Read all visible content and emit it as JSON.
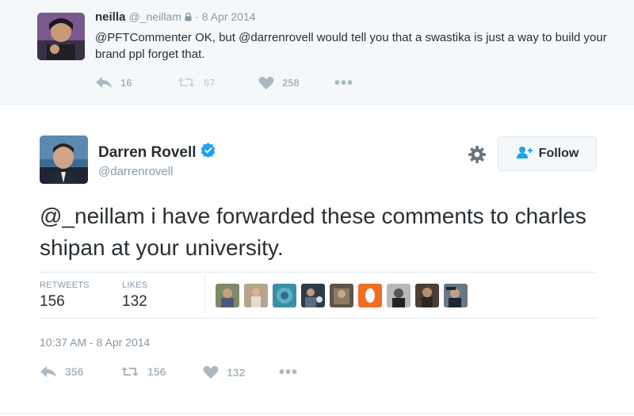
{
  "reply": {
    "name": "neilla",
    "handle": "@_neillam",
    "date_sep": "· 8 Apr 2014",
    "text": "@PFTCommenter OK, but @darrenrovell would tell you that a swastika is just a way to build your brand ppl forget that.",
    "counts": {
      "replies": "16",
      "retweets": "67",
      "likes": "258"
    },
    "more": "•••"
  },
  "tweet": {
    "name": "Darren Rovell",
    "handle": "@darrenrovell",
    "follow_label": "Follow",
    "text": "@_neillam i have forwarded these comments to charles shipan at your university.",
    "stats": {
      "retweets_label": "RETWEETS",
      "retweets_value": "156",
      "likes_label": "LIKES",
      "likes_value": "132"
    },
    "timestamp": "10:37 AM - 8 Apr 2014",
    "actions": {
      "replies": "356",
      "retweets": "156",
      "likes": "132",
      "more": "•••"
    }
  },
  "colors": {
    "accent": "#1da1f2",
    "muted": "#8899a6",
    "icon": "#aab8c2",
    "text": "#292f33",
    "reply_bg": "#f5f8fa",
    "border": "#e1e8ed"
  },
  "icons": [
    "lock-icon",
    "reply-icon",
    "retweet-icon",
    "heart-icon",
    "more-icon",
    "verified-icon",
    "gear-icon",
    "follow-person-icon"
  ]
}
